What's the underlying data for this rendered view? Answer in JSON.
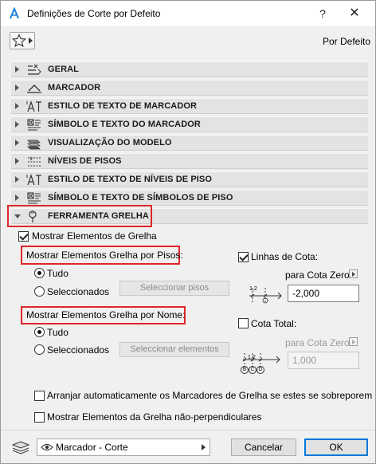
{
  "window": {
    "title": "Definições de Corte por Defeito",
    "help_label": "?",
    "close_label": "✕"
  },
  "header": {
    "favorites_icon": "star-icon",
    "preset_label": "Por Defeito"
  },
  "sections": [
    {
      "label": "GERAL",
      "icon": "general-settings-icon",
      "expanded": false
    },
    {
      "label": "MARCADOR",
      "icon": "marker-icon",
      "expanded": false
    },
    {
      "label": "ESTILO DE TEXTO DE MARCADOR",
      "icon": "text-style-icon",
      "expanded": false
    },
    {
      "label": "SÍMBOLO E TEXTO DO MARCADOR",
      "icon": "symbol-text-icon",
      "expanded": false
    },
    {
      "label": "VISUALIZAÇÃO DO MODELO",
      "icon": "model-display-icon",
      "expanded": false
    },
    {
      "label": "NÍVEIS DE PISOS",
      "icon": "story-levels-icon",
      "expanded": false
    },
    {
      "label": "ESTILO DE TEXTO DE NÍVEIS DE PISO",
      "icon": "text-style-icon",
      "expanded": false
    },
    {
      "label": "SÍMBOLO E TEXTO DE SÍMBOLOS DE PISO",
      "icon": "symbol-text-icon",
      "expanded": false
    },
    {
      "label": "FERRAMENTA GRELHA",
      "icon": "grid-tool-icon",
      "expanded": true
    }
  ],
  "grid_panel": {
    "show_grid_elements": {
      "label": "Mostrar Elementos de Grelha",
      "checked": true
    },
    "by_stories": {
      "heading": "Mostrar Elementos Grelha por Pisos:",
      "options": [
        {
          "label": "Tudo",
          "selected": true
        },
        {
          "label": "Seleccionados",
          "selected": false
        }
      ],
      "select_button": "Seleccionar pisos"
    },
    "by_name": {
      "heading": "Mostrar Elementos Grelha por Nome:",
      "options": [
        {
          "label": "Tudo",
          "selected": true
        },
        {
          "label": "Seleccionados",
          "selected": false
        }
      ],
      "select_button": "Seleccionar elementos"
    },
    "dimension_lines": {
      "label": "Linhas de Cota:",
      "checked": true,
      "zero_label": "para Cota Zero",
      "value": "-2,000",
      "preview_text": "1,2"
    },
    "total_dimension": {
      "label": "Cota Total:",
      "checked": false,
      "zero_label": "para Cota Zero",
      "value": "1,000",
      "preview_text": "1,2",
      "preview_markers": [
        "B",
        "C",
        "D"
      ]
    },
    "auto_arrange": {
      "label": "Arranjar automaticamente os Marcadores de Grelha se estes se sobreporem",
      "checked": false
    },
    "non_perpendicular": {
      "label": "Mostrar Elementos da Grelha não-perpendiculares",
      "checked": false
    }
  },
  "footer": {
    "layer_combo": "Marcador - Corte",
    "cancel_label": "Cancelar",
    "ok_label": "OK"
  },
  "colors": {
    "highlight_red": "#e0262a",
    "section_bar": "#e3e3e3",
    "dialog_bg": "#f0f0f0",
    "ok_border": "#0078d7"
  }
}
